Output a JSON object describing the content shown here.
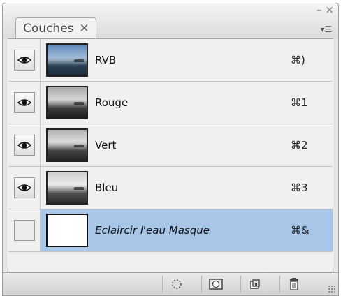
{
  "panel": {
    "tab_label": "Couches",
    "tab_close_glyph": "✕",
    "minimize_glyph": "–",
    "close_glyph": "×",
    "flyout_glyph": "▾☰"
  },
  "channels": [
    {
      "name": "RVB",
      "shortcut": "⌘)",
      "visible": true,
      "thumb": "rgb",
      "selected": false,
      "italic": false
    },
    {
      "name": "Rouge",
      "shortcut": "⌘1",
      "visible": true,
      "thumb": "gray-1",
      "selected": false,
      "italic": false
    },
    {
      "name": "Vert",
      "shortcut": "⌘2",
      "visible": true,
      "thumb": "gray-2",
      "selected": false,
      "italic": false
    },
    {
      "name": "Bleu",
      "shortcut": "⌘3",
      "visible": true,
      "thumb": "gray-3",
      "selected": false,
      "italic": false
    },
    {
      "name": "Eclaircir l'eau Masque",
      "shortcut": "⌘&",
      "visible": false,
      "thumb": "mask",
      "selected": true,
      "italic": true
    }
  ],
  "bottom_bar": {
    "buttons": [
      {
        "icon": "load-selection-icon"
      },
      {
        "icon": "save-selection-icon"
      },
      {
        "icon": "new-channel-icon"
      },
      {
        "icon": "trash-icon"
      }
    ]
  }
}
